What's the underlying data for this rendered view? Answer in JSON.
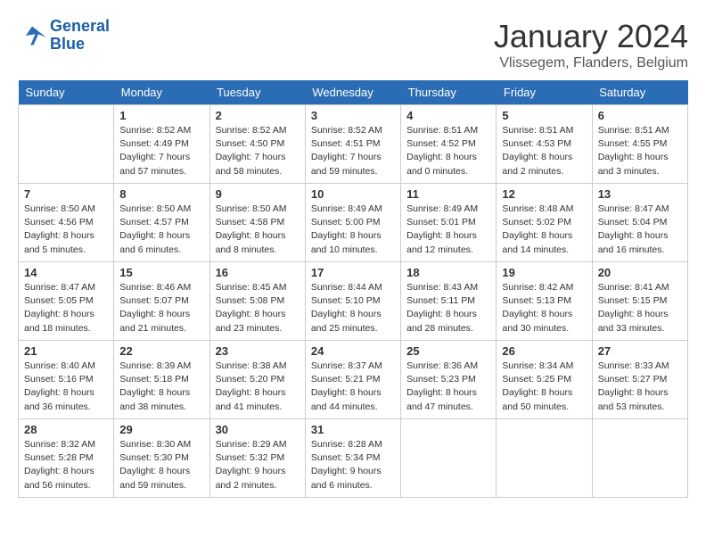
{
  "logo": {
    "line1": "General",
    "line2": "Blue"
  },
  "title": "January 2024",
  "subtitle": "Vlissegem, Flanders, Belgium",
  "days_of_week": [
    "Sunday",
    "Monday",
    "Tuesday",
    "Wednesday",
    "Thursday",
    "Friday",
    "Saturday"
  ],
  "weeks": [
    [
      {
        "day": "",
        "info": ""
      },
      {
        "day": "1",
        "info": "Sunrise: 8:52 AM\nSunset: 4:49 PM\nDaylight: 7 hours\nand 57 minutes."
      },
      {
        "day": "2",
        "info": "Sunrise: 8:52 AM\nSunset: 4:50 PM\nDaylight: 7 hours\nand 58 minutes."
      },
      {
        "day": "3",
        "info": "Sunrise: 8:52 AM\nSunset: 4:51 PM\nDaylight: 7 hours\nand 59 minutes."
      },
      {
        "day": "4",
        "info": "Sunrise: 8:51 AM\nSunset: 4:52 PM\nDaylight: 8 hours\nand 0 minutes."
      },
      {
        "day": "5",
        "info": "Sunrise: 8:51 AM\nSunset: 4:53 PM\nDaylight: 8 hours\nand 2 minutes."
      },
      {
        "day": "6",
        "info": "Sunrise: 8:51 AM\nSunset: 4:55 PM\nDaylight: 8 hours\nand 3 minutes."
      }
    ],
    [
      {
        "day": "7",
        "info": "Sunrise: 8:50 AM\nSunset: 4:56 PM\nDaylight: 8 hours\nand 5 minutes."
      },
      {
        "day": "8",
        "info": "Sunrise: 8:50 AM\nSunset: 4:57 PM\nDaylight: 8 hours\nand 6 minutes."
      },
      {
        "day": "9",
        "info": "Sunrise: 8:50 AM\nSunset: 4:58 PM\nDaylight: 8 hours\nand 8 minutes."
      },
      {
        "day": "10",
        "info": "Sunrise: 8:49 AM\nSunset: 5:00 PM\nDaylight: 8 hours\nand 10 minutes."
      },
      {
        "day": "11",
        "info": "Sunrise: 8:49 AM\nSunset: 5:01 PM\nDaylight: 8 hours\nand 12 minutes."
      },
      {
        "day": "12",
        "info": "Sunrise: 8:48 AM\nSunset: 5:02 PM\nDaylight: 8 hours\nand 14 minutes."
      },
      {
        "day": "13",
        "info": "Sunrise: 8:47 AM\nSunset: 5:04 PM\nDaylight: 8 hours\nand 16 minutes."
      }
    ],
    [
      {
        "day": "14",
        "info": "Sunrise: 8:47 AM\nSunset: 5:05 PM\nDaylight: 8 hours\nand 18 minutes."
      },
      {
        "day": "15",
        "info": "Sunrise: 8:46 AM\nSunset: 5:07 PM\nDaylight: 8 hours\nand 21 minutes."
      },
      {
        "day": "16",
        "info": "Sunrise: 8:45 AM\nSunset: 5:08 PM\nDaylight: 8 hours\nand 23 minutes."
      },
      {
        "day": "17",
        "info": "Sunrise: 8:44 AM\nSunset: 5:10 PM\nDaylight: 8 hours\nand 25 minutes."
      },
      {
        "day": "18",
        "info": "Sunrise: 8:43 AM\nSunset: 5:11 PM\nDaylight: 8 hours\nand 28 minutes."
      },
      {
        "day": "19",
        "info": "Sunrise: 8:42 AM\nSunset: 5:13 PM\nDaylight: 8 hours\nand 30 minutes."
      },
      {
        "day": "20",
        "info": "Sunrise: 8:41 AM\nSunset: 5:15 PM\nDaylight: 8 hours\nand 33 minutes."
      }
    ],
    [
      {
        "day": "21",
        "info": "Sunrise: 8:40 AM\nSunset: 5:16 PM\nDaylight: 8 hours\nand 36 minutes."
      },
      {
        "day": "22",
        "info": "Sunrise: 8:39 AM\nSunset: 5:18 PM\nDaylight: 8 hours\nand 38 minutes."
      },
      {
        "day": "23",
        "info": "Sunrise: 8:38 AM\nSunset: 5:20 PM\nDaylight: 8 hours\nand 41 minutes."
      },
      {
        "day": "24",
        "info": "Sunrise: 8:37 AM\nSunset: 5:21 PM\nDaylight: 8 hours\nand 44 minutes."
      },
      {
        "day": "25",
        "info": "Sunrise: 8:36 AM\nSunset: 5:23 PM\nDaylight: 8 hours\nand 47 minutes."
      },
      {
        "day": "26",
        "info": "Sunrise: 8:34 AM\nSunset: 5:25 PM\nDaylight: 8 hours\nand 50 minutes."
      },
      {
        "day": "27",
        "info": "Sunrise: 8:33 AM\nSunset: 5:27 PM\nDaylight: 8 hours\nand 53 minutes."
      }
    ],
    [
      {
        "day": "28",
        "info": "Sunrise: 8:32 AM\nSunset: 5:28 PM\nDaylight: 8 hours\nand 56 minutes."
      },
      {
        "day": "29",
        "info": "Sunrise: 8:30 AM\nSunset: 5:30 PM\nDaylight: 8 hours\nand 59 minutes."
      },
      {
        "day": "30",
        "info": "Sunrise: 8:29 AM\nSunset: 5:32 PM\nDaylight: 9 hours\nand 2 minutes."
      },
      {
        "day": "31",
        "info": "Sunrise: 8:28 AM\nSunset: 5:34 PM\nDaylight: 9 hours\nand 6 minutes."
      },
      {
        "day": "",
        "info": ""
      },
      {
        "day": "",
        "info": ""
      },
      {
        "day": "",
        "info": ""
      }
    ]
  ]
}
